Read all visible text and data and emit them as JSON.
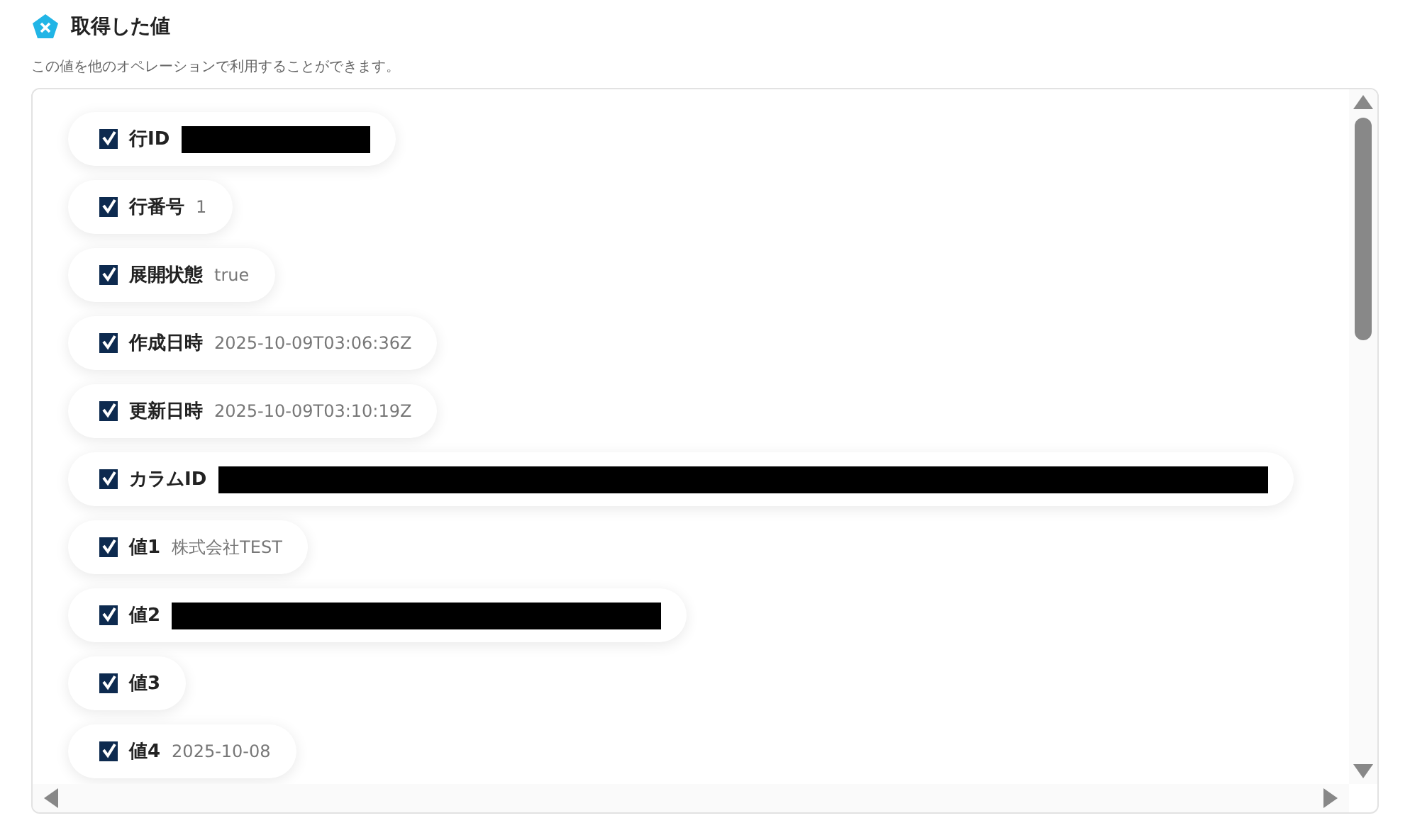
{
  "header": {
    "title": "取得した値",
    "description": "この値を他のオペレーションで利用することができます。"
  },
  "items": [
    {
      "label": "行ID",
      "checked": true,
      "kind": "redacted"
    },
    {
      "label": "行番号",
      "checked": true,
      "kind": "text",
      "value": "1"
    },
    {
      "label": "展開状態",
      "checked": true,
      "kind": "text",
      "value": "true"
    },
    {
      "label": "作成日時",
      "checked": true,
      "kind": "text",
      "value": "2025-10-09T03:06:36Z"
    },
    {
      "label": "更新日時",
      "checked": true,
      "kind": "text",
      "value": "2025-10-09T03:10:19Z"
    },
    {
      "label": "カラムID",
      "checked": true,
      "kind": "redacted"
    },
    {
      "label": "値1",
      "checked": true,
      "kind": "text",
      "value": "株式会社TEST"
    },
    {
      "label": "値2",
      "checked": true,
      "kind": "redacted"
    },
    {
      "label": "値3",
      "checked": true,
      "kind": "empty"
    },
    {
      "label": "値4",
      "checked": true,
      "kind": "text",
      "value": "2025-10-08"
    }
  ]
}
